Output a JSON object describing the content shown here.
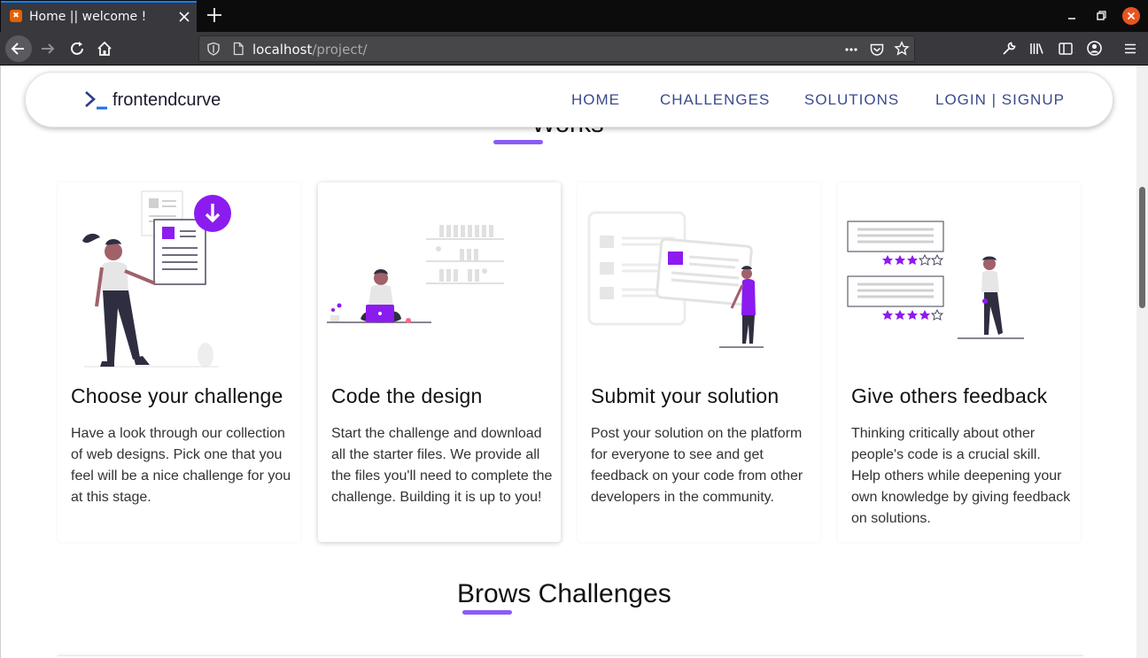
{
  "browser": {
    "tab_title": "Home || welcome !",
    "url_host": "localhost",
    "url_path": "/project/"
  },
  "page": {
    "top_section_title": "Works",
    "logo_text": "frontendcurve",
    "nav": [
      {
        "label": "HOME"
      },
      {
        "label": "CHALLENGES"
      },
      {
        "label": "SOLUTIONS"
      },
      {
        "label": "LOGIN | SIGNUP"
      }
    ],
    "cards": [
      {
        "title": "Choose your challenge",
        "text": "Have a look through our collection of web designs. Pick one that you feel will be a nice challenge for you at this stage."
      },
      {
        "title": "Code the design",
        "text": "Start the challenge and download all the starter files. We provide all the files you'll need to complete the challenge. Building it is up to you!"
      },
      {
        "title": "Submit your solution",
        "text": "Post your solution on the platform for everyone to see and get feedback on your code from other developers in the community."
      },
      {
        "title": "Give others feedback",
        "text": "Thinking critically about other people's code is a crucial skill. Help others while deepening your own knowledge by giving feedback on solutions."
      }
    ],
    "section_title": "Brows Challenges"
  },
  "colors": {
    "accent": "#8a5cf6",
    "illustration_purple": "#8c1bf0",
    "nav_text": "#3b4a8f",
    "browser_dark": "#0c0c0d",
    "toolbar": "#38383d"
  }
}
